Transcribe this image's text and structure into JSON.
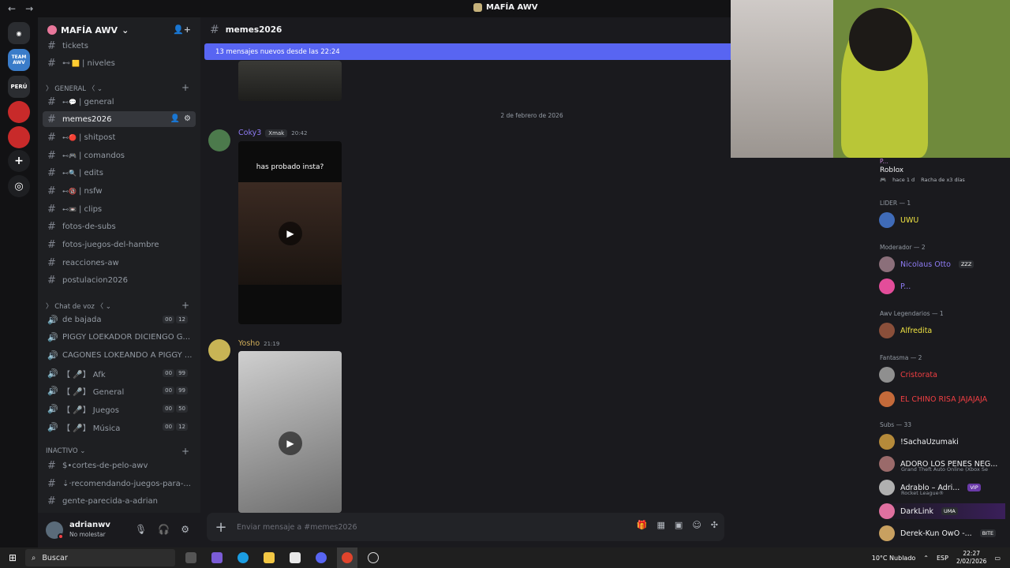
{
  "titlebar": {
    "title": "MAFÍA AWV",
    "back": "←",
    "forward": "→"
  },
  "servers": [
    {
      "name": "server-discord-home",
      "label": "◉",
      "color": "#2b2d31"
    },
    {
      "name": "server-team-awv",
      "label": "TEAM AWV",
      "color": "#3a7cc9"
    },
    {
      "name": "server-peru",
      "label": "PERÚ",
      "color": "#2b2d31"
    },
    {
      "name": "server-red-1",
      "label": "",
      "color": "#c82a2a"
    },
    {
      "name": "server-red-2",
      "label": "",
      "color": "#c82a2a"
    },
    {
      "name": "server-add",
      "label": "+",
      "color": "#2b2d31"
    },
    {
      "name": "server-explore",
      "label": "◎",
      "color": "#2b2d31"
    }
  ],
  "guild": {
    "name": "MAFÍA AWV",
    "chevron": "⌄"
  },
  "channels": {
    "top": [
      {
        "label": "tickets"
      },
      {
        "label": "| niveles",
        "emoji": "🟨"
      }
    ],
    "general_cat": "GENERAL 〈 ⌄",
    "general": [
      {
        "label": "| general",
        "prefix": "⊷💬"
      },
      {
        "label": "memes2026",
        "active": true
      },
      {
        "label": "| shitpost",
        "prefix": "⊷🔴"
      },
      {
        "label": "| comandos",
        "prefix": "⊷🎮"
      },
      {
        "label": "| edits",
        "prefix": "⊷🔍"
      },
      {
        "label": "| nsfw",
        "prefix": "⊷🔞"
      },
      {
        "label": "| clips",
        "prefix": "⊷📼"
      },
      {
        "label": "fotos-de-subs"
      },
      {
        "label": "fotos-juegos-del-hambre"
      },
      {
        "label": "reacciones-aw"
      },
      {
        "label": "postulacion2026"
      }
    ],
    "voice_cat": "Chat de voz 〈 ⌄",
    "voice": [
      {
        "label": "de bajada",
        "c1": "00",
        "c2": "12"
      },
      {
        "label": "PIGGY LOEKADOR DICIENGO G..."
      },
      {
        "label": "CAGONES LOKEANDO A PIGGY ..."
      },
      {
        "label": "【 🎤】 Afk",
        "c1": "00",
        "c2": "99"
      },
      {
        "label": "【 🎤】 General",
        "c1": "00",
        "c2": "99"
      },
      {
        "label": "【 🎤】 Juegos",
        "c1": "00",
        "c2": "50"
      },
      {
        "label": "【 🎤】 Música",
        "c1": "00",
        "c2": "12"
      }
    ],
    "inactive_cat": "INACTIVO ⌄",
    "inactive": [
      {
        "label": "$•cortes-de-pelo-awv"
      },
      {
        "label": "⇣·recomendando-juegos-para-..."
      },
      {
        "label": "gente-parecida-a-adrian"
      }
    ]
  },
  "user": {
    "name": "adrianwv",
    "status": "No molestar"
  },
  "main": {
    "channel": "memes2026",
    "new_messages": "13 mensajes nuevos desde las 22:24",
    "date_separator": "2 de febrero de 2026",
    "messages": [
      {
        "author": "Coky3",
        "tag": "Xmak",
        "time": "20:42",
        "author_color": "#8f7cf5",
        "video_caption": "has probado insta?"
      },
      {
        "author": "Yosho",
        "time": "21:19",
        "author_color": "#d4b05a"
      }
    ],
    "composer_placeholder": "Enviar mensaje a #memes2026"
  },
  "members": {
    "activity": {
      "name": "Roblox",
      "detail1": "hace 1 d",
      "detail2": "Racha de x3 días",
      "top": "P..."
    },
    "groups": [
      {
        "role": "LIDER — 1",
        "members": [
          {
            "name": "UWU",
            "color": "#f0e442"
          }
        ]
      },
      {
        "role": "Moderador — 2",
        "members": [
          {
            "name": "Nicolaus Otto",
            "color": "#8f7cf5",
            "badge": "ZZZ"
          },
          {
            "name": "P...",
            "color": "#8f7cf5"
          }
        ]
      },
      {
        "role": "Awv Legendarios — 1",
        "members": [
          {
            "name": "Alfredita",
            "color": "#f0e442"
          }
        ]
      },
      {
        "role": "Fantasma — 2",
        "members": [
          {
            "name": "Cristorata",
            "color": "#f23f43"
          },
          {
            "name": "EL CHINO RISA JAJAJAJA",
            "color": "#f23f43"
          }
        ]
      },
      {
        "role": "Subs — 33",
        "members": [
          {
            "name": "!SachaUzumaki",
            "color": "#f2f3f5"
          },
          {
            "name": "ADORO LOS PENES NEG...",
            "color": "#f2f3f5",
            "sub": "Grand Theft Auto Online (Xbox Se"
          },
          {
            "name": "Adrablo – Adri...",
            "color": "#f2f3f5",
            "sub": "Rocket League®",
            "badge": "VIP"
          },
          {
            "name": "DarkLink",
            "color": "#f2f3f5",
            "badge": "UMA"
          },
          {
            "name": "Derek-Kun OwO -...",
            "color": "#f2f3f5",
            "badge": "BITE"
          }
        ]
      }
    ]
  },
  "taskbar": {
    "search": "Buscar",
    "weather": "10°C  Nublado",
    "lang": "ESP",
    "time": "22:27",
    "date": "2/02/2026"
  }
}
